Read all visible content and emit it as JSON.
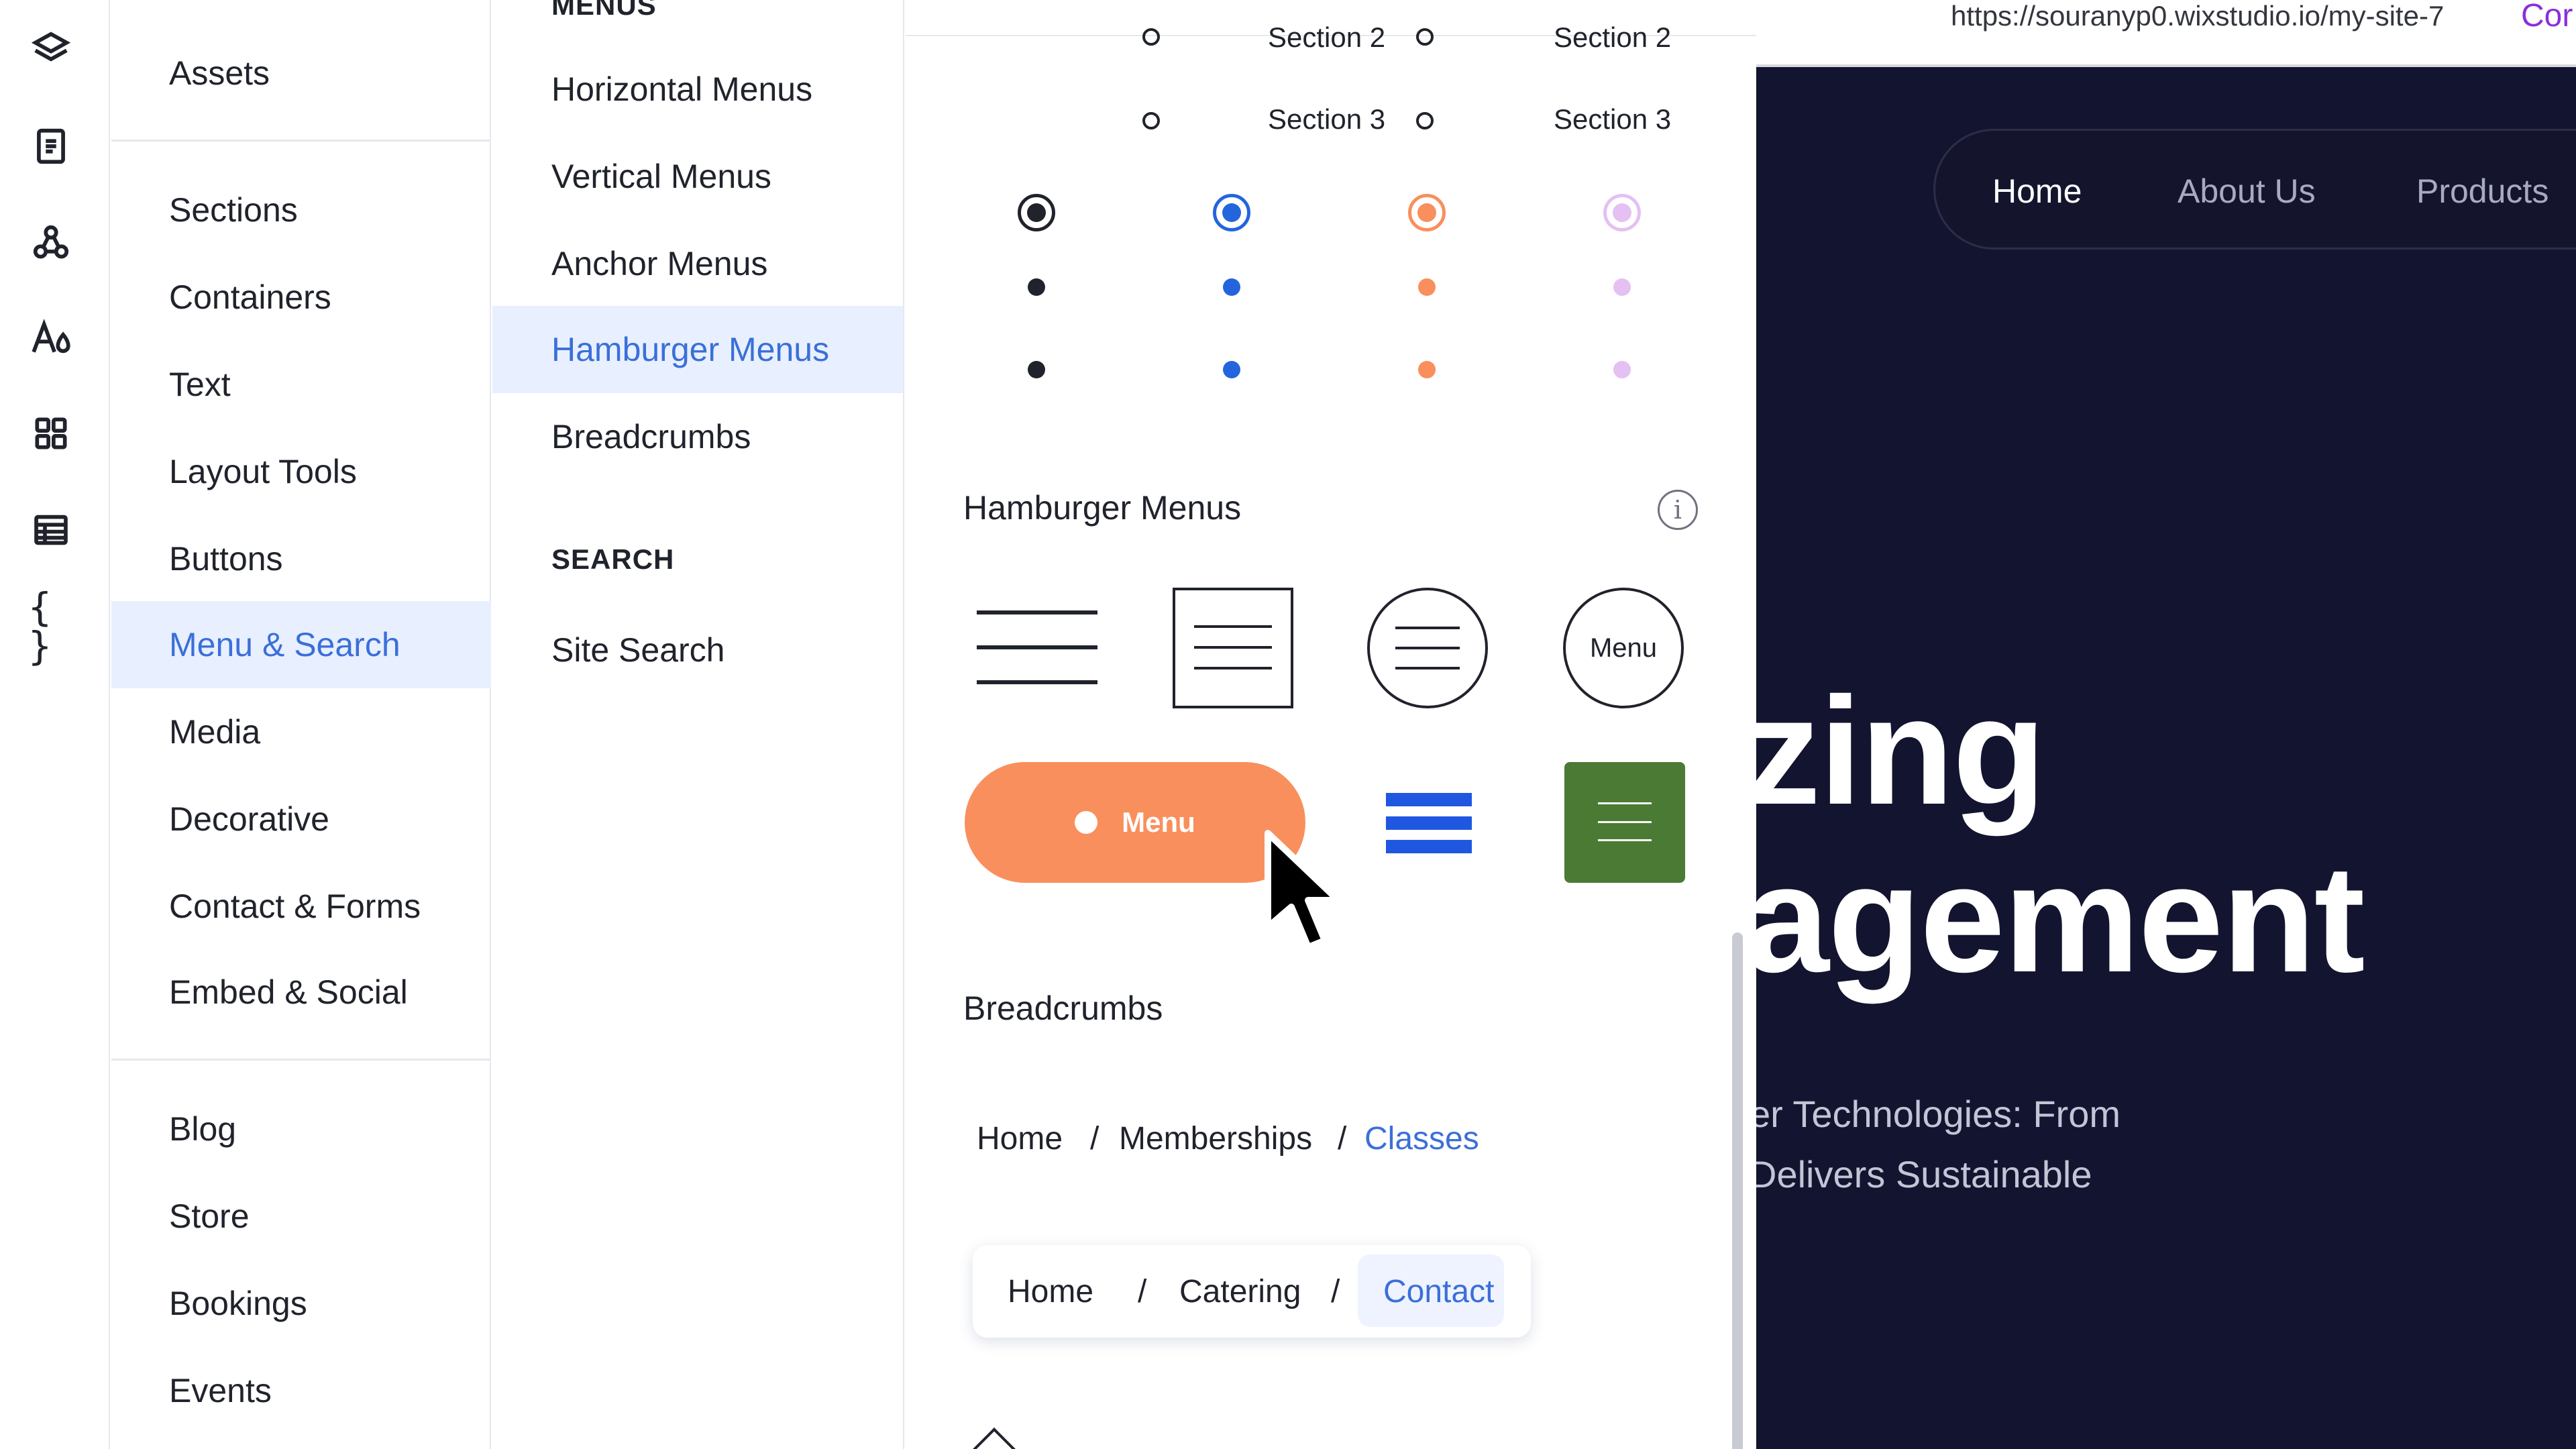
{
  "rail": {
    "icons": [
      "layers-icon",
      "page-icon",
      "components-icon",
      "typography-icon",
      "apps-icon",
      "table-icon",
      "code-braces-icon"
    ],
    "braces_glyph": "{ }"
  },
  "categories": {
    "items": [
      "Assets",
      "Sections",
      "Containers",
      "Text",
      "Layout Tools",
      "Buttons",
      "Menu & Search",
      "Media",
      "Decorative",
      "Contact & Forms",
      "Embed & Social",
      "Blog",
      "Store",
      "Bookings",
      "Events"
    ],
    "active": "Menu & Search"
  },
  "subcategories": {
    "menus_heading": "MENUS",
    "menus": [
      "Horizontal Menus",
      "Vertical Menus",
      "Anchor Menus",
      "Hamburger Menus",
      "Breadcrumbs"
    ],
    "active": "Hamburger Menus",
    "search_heading": "SEARCH",
    "search": [
      "Site Search"
    ]
  },
  "panel": {
    "anchor_labels": [
      "Section 2",
      "Section 2",
      "Section 3",
      "Section 3"
    ],
    "swatch_colors": [
      "#20232c",
      "#2465de",
      "#f98f5c",
      "#e5c0f2"
    ],
    "hamburger_title": "Hamburger Menus",
    "info_glyph": "i",
    "circle_menu_label": "Menu",
    "pill_menu_label": "Menu",
    "pill_color": "#f98f5c",
    "blue_bars_color": "#1f57e0",
    "green_box_color": "#4b7a35",
    "breadcrumbs_title": "Breadcrumbs",
    "crumbs1": [
      "Home",
      "/",
      "Memberships",
      "/",
      "Classes"
    ],
    "crumbs2": [
      "Home",
      "/",
      "Catering",
      "/",
      "Contact"
    ]
  },
  "site": {
    "url": "https://souranyp0.wixstudio.io/my-site-7",
    "url_extra": "Cor",
    "nav": [
      "Home",
      "About Us",
      "Products"
    ],
    "hero_line1": "zing",
    "hero_line2": "agement",
    "sub_line1": "er Technologies: From",
    "sub_line2": "Delivers Sustainable",
    "bg_color": "#13142f"
  }
}
